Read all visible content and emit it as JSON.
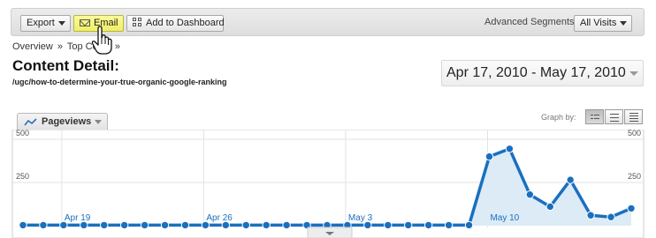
{
  "toolbar": {
    "export_label": "Export",
    "email_label": "Email",
    "dashboard_label": "Add to Dashboard",
    "segments_label": "Advanced Segments:",
    "segments_value": "All Visits"
  },
  "breadcrumb": [
    "Overview",
    "»",
    "Top Co",
    "»"
  ],
  "page": {
    "title": "Content Detail:",
    "path": "/ugc/how-to-determine-your-true-organic-google-ranking"
  },
  "date_range": "Apr 17, 2010 - May 17, 2010",
  "metric_tab": "Pageviews",
  "graph_by_label": "Graph by:",
  "icons": [
    "chevron-down-icon",
    "envelope-icon",
    "dashboard-grid-icon",
    "hand-cursor-icon",
    "line-chart-icon"
  ],
  "colors": {
    "line": "#1a6fbf",
    "area": "#dcebf6",
    "email_highlight": "#f3f26a"
  },
  "chart_data": {
    "type": "area",
    "y_ticks": [
      "500",
      "250"
    ],
    "ylim": [
      0,
      500
    ],
    "x_ticks": [
      "Apr 19",
      "Apr 26",
      "May 3",
      "May 10"
    ],
    "x_tick_index": [
      2,
      9,
      16,
      23
    ],
    "x": [
      "Apr 17",
      "Apr 18",
      "Apr 19",
      "Apr 20",
      "Apr 21",
      "Apr 22",
      "Apr 23",
      "Apr 24",
      "Apr 25",
      "Apr 26",
      "Apr 27",
      "Apr 28",
      "Apr 29",
      "Apr 30",
      "May 1",
      "May 2",
      "May 3",
      "May 4",
      "May 5",
      "May 6",
      "May 7",
      "May 8",
      "May 9",
      "May 10",
      "May 11",
      "May 12",
      "May 13",
      "May 14",
      "May 15",
      "May 16",
      "May 17"
    ],
    "values": [
      3,
      3,
      3,
      3,
      3,
      3,
      3,
      3,
      3,
      3,
      3,
      3,
      3,
      3,
      3,
      3,
      3,
      3,
      3,
      3,
      3,
      3,
      3,
      400,
      445,
      180,
      110,
      265,
      60,
      50,
      100
    ],
    "grid": true
  }
}
